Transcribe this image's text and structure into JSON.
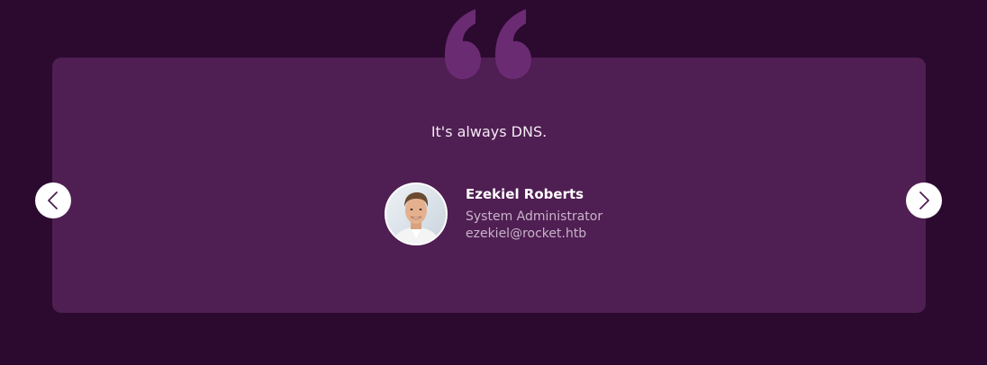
{
  "testimonial": {
    "quote": "It's always DNS.",
    "author_name": "Ezekiel Roberts",
    "author_role": "System Administrator",
    "author_email": "ezekiel@rocket.htb"
  },
  "icons": {
    "quote": "quote-icon",
    "prev": "chevron-left-icon",
    "next": "chevron-right-icon"
  },
  "colors": {
    "background": "#2c0a30",
    "card": "#4f1e52",
    "quote_icon": "#6b2b72",
    "text": "#f3e9f4",
    "muted_text": "#c8b3cb",
    "button": "#ffffff"
  }
}
